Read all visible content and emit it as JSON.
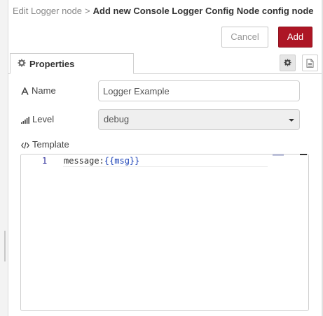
{
  "breadcrumb": {
    "parent": "Edit Logger node",
    "separator": ">",
    "current": "Add new Console Logger Config Node config node"
  },
  "buttons": {
    "cancel": "Cancel",
    "add": "Add"
  },
  "colors": {
    "add_button": "#ad1625",
    "code_template": "#1e44b8"
  },
  "tabs": [
    {
      "label": "Properties",
      "icon": "gear-icon"
    }
  ],
  "tab_buttons": [
    {
      "icon": "gear-icon"
    },
    {
      "icon": "document-icon"
    }
  ],
  "form": {
    "name": {
      "label": "Name",
      "icon": "letter-a-icon",
      "value": "Logger Example"
    },
    "level": {
      "label": "Level",
      "icon": "signal-bars-icon",
      "value": "debug"
    },
    "template": {
      "label": "Template",
      "icon": "code-icon",
      "line_number": "1",
      "code_key": "message:",
      "code_value": "{{msg}}"
    }
  }
}
